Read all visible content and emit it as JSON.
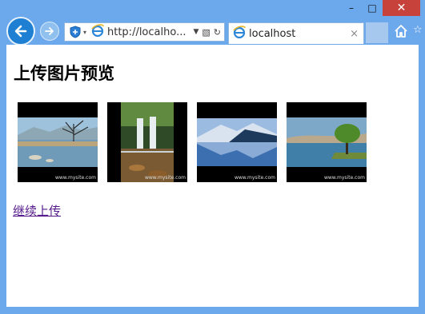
{
  "browser": {
    "address_url": "http://localho...",
    "tab_title": "localhost",
    "tab_close": "×",
    "win_min": "–",
    "win_max": "□",
    "win_close": "✕"
  },
  "page": {
    "heading": "上传图片预览",
    "images": [
      {
        "scene": "lake-tree",
        "watermark": "www.mysite.com"
      },
      {
        "scene": "waterfall",
        "watermark": "www.mysite.com"
      },
      {
        "scene": "mountain-lake",
        "watermark": "www.mysite.com"
      },
      {
        "scene": "willow-shore",
        "watermark": "www.mysite.com"
      }
    ],
    "continue_link": "继续上传"
  },
  "colors": {
    "frame": "#6ca8ec",
    "close_button": "#c7423b",
    "link_visited": "#551a8b"
  }
}
